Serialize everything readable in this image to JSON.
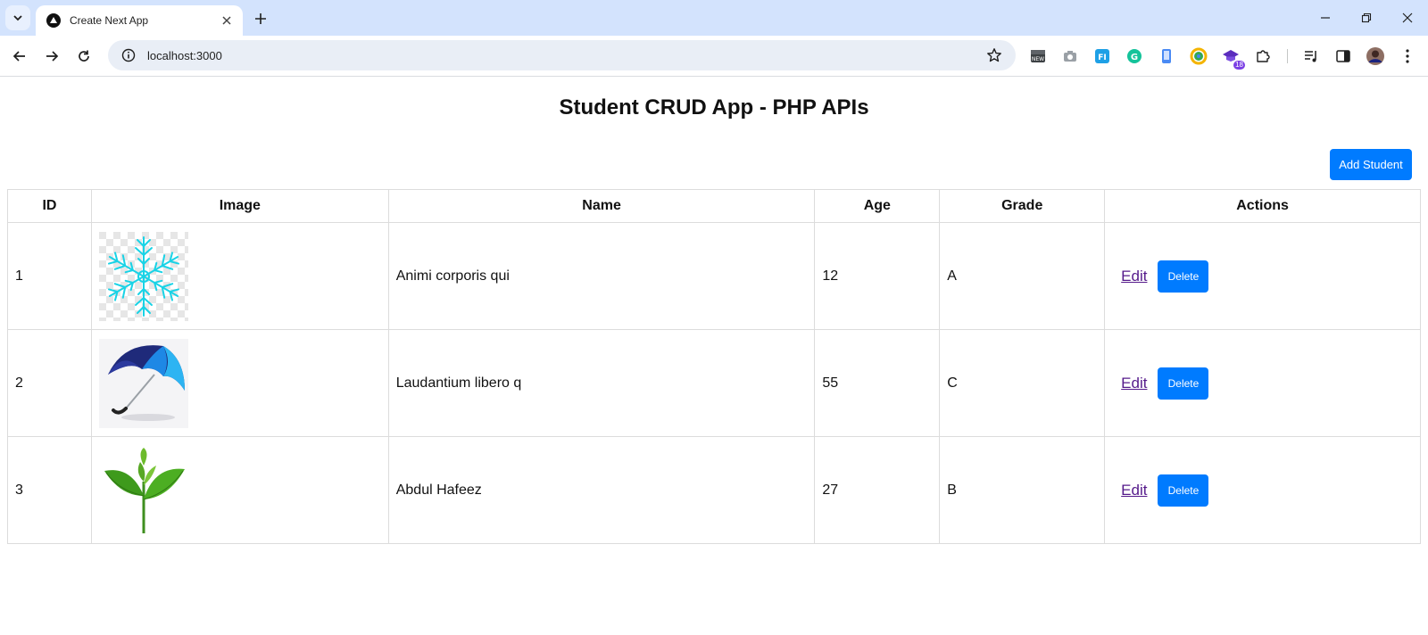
{
  "browser": {
    "tab_title": "Create Next App",
    "url": "localhost:3000",
    "extension_badge": "18"
  },
  "page": {
    "title": "Student CRUD App - PHP APIs",
    "add_button_label": "Add Student",
    "table": {
      "headers": [
        "ID",
        "Image",
        "Name",
        "Age",
        "Grade",
        "Actions"
      ],
      "rows": [
        {
          "id": "1",
          "image": "snowflake-image",
          "name": "Animi corporis qui",
          "age": "12",
          "grade": "A",
          "edit_label": "Edit",
          "delete_label": "Delete"
        },
        {
          "id": "2",
          "image": "umbrella-image",
          "name": "Laudantium libero q",
          "age": "55",
          "grade": "C",
          "edit_label": "Edit",
          "delete_label": "Delete"
        },
        {
          "id": "3",
          "image": "leaf-image",
          "name": "Abdul Hafeez",
          "age": "27",
          "grade": "B",
          "edit_label": "Edit",
          "delete_label": "Delete"
        }
      ]
    }
  },
  "colors": {
    "tabstrip": "#d3e3fd",
    "primary_button": "#007bff",
    "visited_link": "#551a8b"
  }
}
